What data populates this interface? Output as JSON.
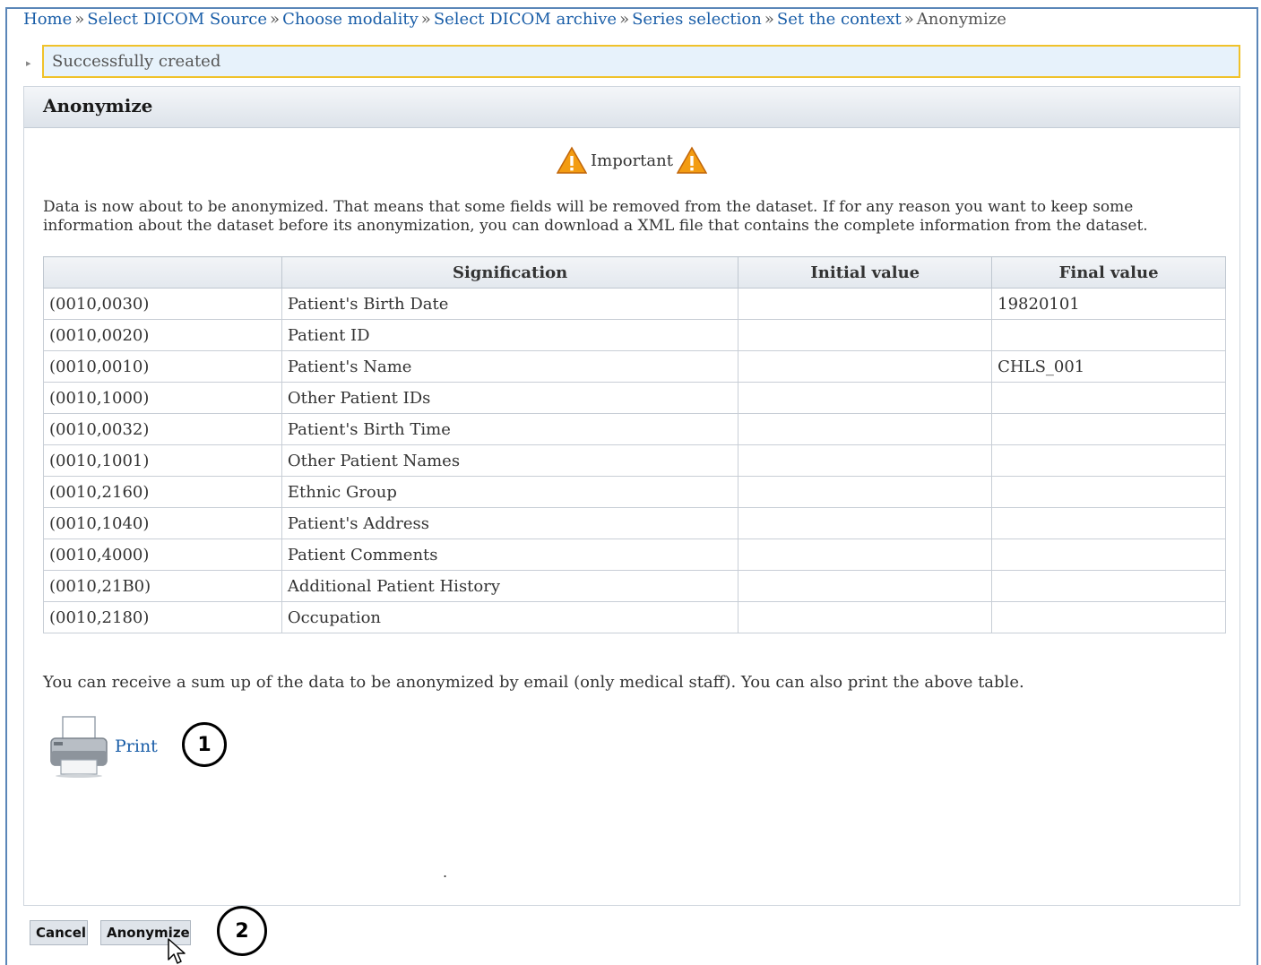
{
  "breadcrumb": {
    "items": [
      {
        "label": "Home"
      },
      {
        "label": "Select DICOM Source"
      },
      {
        "label": "Choose modality"
      },
      {
        "label": "Select DICOM archive"
      },
      {
        "label": "Series selection"
      },
      {
        "label": "Set the context"
      }
    ],
    "separator": "»",
    "current": "Anonymize"
  },
  "message": {
    "text": "Successfully created",
    "border_color": "#f0c22a",
    "background": "#e7f2fb"
  },
  "panel": {
    "title": "Anonymize",
    "important_label": "Important",
    "info_text": "Data is now about to be anonymized. That means that some fields will be removed from the dataset. If for any reason you want to keep some information about the dataset before its anonymization, you can download a XML file that contains the complete information from the dataset.",
    "table": {
      "headers": [
        "",
        "Signification",
        "Initial value",
        "Final value"
      ],
      "rows": [
        {
          "tag": "(0010,0030)",
          "signification": "Patient's Birth Date",
          "initial": "",
          "final": "19820101"
        },
        {
          "tag": "(0010,0020)",
          "signification": "Patient ID",
          "initial": "",
          "final": ""
        },
        {
          "tag": "(0010,0010)",
          "signification": "Patient's Name",
          "initial": "",
          "final": "CHLS_001"
        },
        {
          "tag": "(0010,1000)",
          "signification": "Other Patient IDs",
          "initial": "",
          "final": ""
        },
        {
          "tag": "(0010,0032)",
          "signification": "Patient's Birth Time",
          "initial": "",
          "final": ""
        },
        {
          "tag": "(0010,1001)",
          "signification": "Other Patient Names",
          "initial": "",
          "final": ""
        },
        {
          "tag": "(0010,2160)",
          "signification": "Ethnic Group",
          "initial": "",
          "final": ""
        },
        {
          "tag": "(0010,1040)",
          "signification": "Patient's Address",
          "initial": "",
          "final": ""
        },
        {
          "tag": "(0010,4000)",
          "signification": "Patient Comments",
          "initial": "",
          "final": ""
        },
        {
          "tag": "(0010,21B0)",
          "signification": "Additional Patient History",
          "initial": "",
          "final": ""
        },
        {
          "tag": "(0010,2180)",
          "signification": "Occupation",
          "initial": "",
          "final": ""
        }
      ]
    },
    "sumup_text": "You can receive a sum up of the data to be anonymized by email (only medical staff). You can also print the above table.",
    "print_label": "Print",
    "print_icon": "printer-icon",
    "dot": "."
  },
  "annotations": {
    "step1": "1",
    "step2": "2"
  },
  "buttons": {
    "cancel": "Cancel",
    "anonymize": "Anonymize"
  },
  "colors": {
    "link": "#1a5ea8",
    "frame": "#5a86b8",
    "warning": "#f39c12"
  }
}
